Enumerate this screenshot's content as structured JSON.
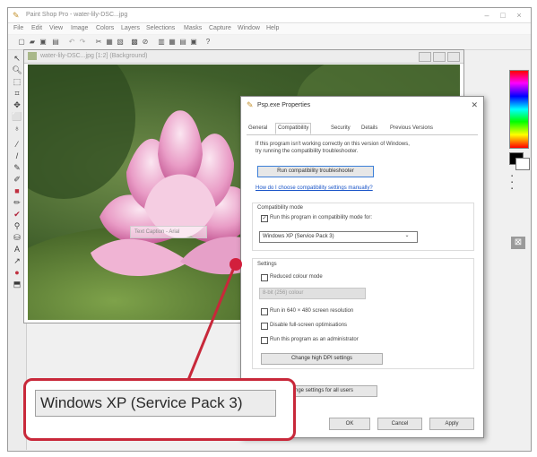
{
  "app": {
    "title": "Paint Shop Pro - water-lily-DSC...jpg",
    "menu": [
      "File",
      "Edit",
      "View",
      "Image",
      "Colors",
      "Layers",
      "Selections",
      "Masks",
      "Capture",
      "Window",
      "Help"
    ],
    "window_buttons": [
      "–",
      "□",
      "×"
    ]
  },
  "toolbar_icons": [
    "new-icon",
    "open-icon",
    "save-icon",
    "print-icon",
    "undo-icon",
    "redo-icon",
    "cut-icon",
    "copy-icon",
    "paste-icon",
    "browse-icon",
    "zoom-icon",
    "grid-icon",
    "image-icon",
    "palette-icon",
    "layers-icon",
    "help-icon"
  ],
  "tool_icons": [
    "select-arrow-icon",
    "zoom-tool-icon",
    "deform-icon",
    "crop-icon",
    "move-icon",
    "selection-icon",
    "lasso-icon",
    "eyedropper-icon",
    "paintbrush-icon",
    "clone-icon",
    "color-replace-icon",
    "retouch-icon",
    "eraser-icon",
    "picture-tube-icon",
    "airbrush-icon",
    "flood-fill-icon",
    "text-icon",
    "draw-icon",
    "preset-shapes-icon",
    "cutout-icon"
  ],
  "image_window": {
    "title": "water-lily-DSC...jpg [1:2] (Background)",
    "caption_placeholder": "Text Caption - Arial"
  },
  "dialog": {
    "title": "Psp.exe Properties",
    "tabs": [
      "General",
      "Compatibility",
      "Security",
      "Details",
      "Previous Versions"
    ],
    "active_tab": "Compatibility",
    "intro_line1": "If this program isn't working correctly on this version of Windows,",
    "intro_line2": "try running the compatibility troubleshooter.",
    "troubleshooter_button": "Run compatibility troubleshooter",
    "manual_link": "How do I choose compatibility settings manually?",
    "compat_mode_label": "Compatibility mode",
    "compat_mode_checkbox": "Run this program in compatibility mode for:",
    "compat_mode_value": "Windows XP (Service Pack 3)",
    "settings_label": "Settings",
    "reduced_colour": "Reduced colour mode",
    "colour_value": "8-bit (256) colour",
    "run_640": "Run in 640 × 480 screen resolution",
    "disable_fullscreen": "Disable full-screen optimisations",
    "run_admin": "Run this program as an administrator",
    "dpi_button": "Change high DPI settings",
    "all_users_button": "Change settings for all users",
    "ok": "OK",
    "cancel": "Cancel",
    "apply": "Apply"
  },
  "callout": {
    "text": "Windows XP (Service Pack 3)",
    "color": "#c8283a"
  },
  "colors": {
    "accent_red": "#c8283a",
    "link_blue": "#1a55c8"
  }
}
